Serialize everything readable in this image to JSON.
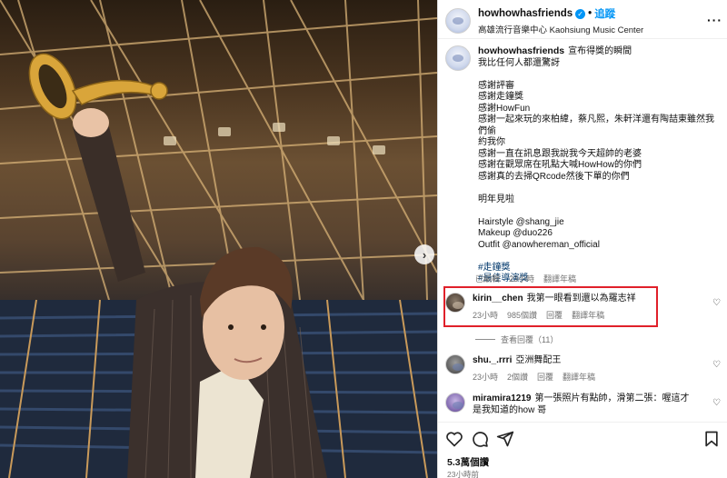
{
  "post_header": {
    "username": "howhowhasfriends",
    "follow_label": "追蹤",
    "location": "高雄流行音樂中心 Kaohsiung Music Center"
  },
  "caption": {
    "username": "howhowhasfriends",
    "lines": [
      "宣布得獎的瞬間",
      "我比任何人都還驚訝",
      "",
      "感謝評審",
      "感謝走鐘獎",
      "感謝HowFun",
      "感謝一起來玩的來柏緯，蔡凡熙，朱軒洋還有陶喆東雖然我們偷",
      "約我你",
      "感謝一直在訊息跟我說我今天超帥的老婆",
      "感謝在觀眾席在吼點大喊HowHow的你們",
      "感謝真的去掃QRcode然後下單的你們",
      "",
      "明年見啦",
      "",
      "Hairstyle @shang_jie",
      "Makeup @duo226",
      "Outfit @anowhereman_official",
      "",
      "#走鐘獎",
      "#最佳導演獎"
    ],
    "meta": [
      "已編輯",
      "23小時",
      "翻譯年稿"
    ]
  },
  "comments": [
    {
      "username": "kirin__chen",
      "text": "我第一眼看到還以為羅志祥",
      "meta": [
        "23小時",
        "985個讚",
        "回覆",
        "翻譯年稿"
      ]
    },
    {
      "username": "shu._.rrri",
      "text": "亞洲舞配王",
      "meta": [
        "23小時",
        "2個讚",
        "回覆",
        "翻譯年稿"
      ]
    },
    {
      "username": "miramira1219",
      "text": "第一張照片有點帥，滑第二張：喔這才是我知道的how 哥",
      "meta": []
    }
  ],
  "view_replies_label": "查看回覆（11）",
  "likes_label": "5.3萬個讚",
  "timestamp": "23小時前",
  "colors": {
    "accent": "#0095f6",
    "highlight": "#e0202a",
    "muted": "#737373"
  }
}
